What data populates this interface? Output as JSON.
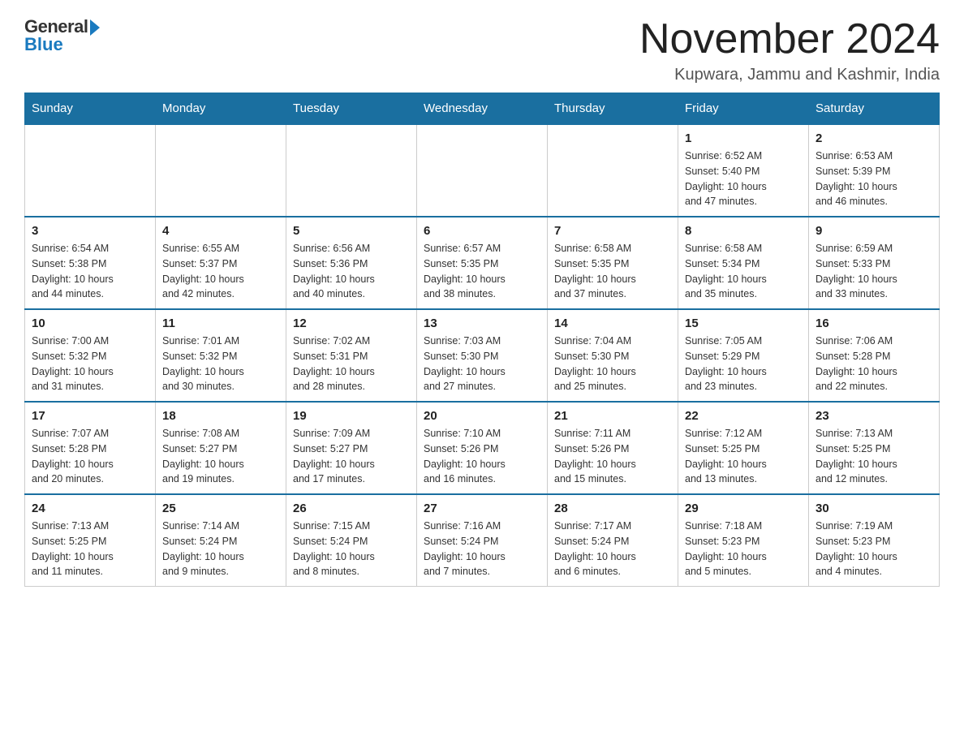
{
  "logo": {
    "general_text": "General",
    "blue_text": "Blue"
  },
  "header": {
    "month_year": "November 2024",
    "location": "Kupwara, Jammu and Kashmir, India"
  },
  "weekdays": [
    "Sunday",
    "Monday",
    "Tuesday",
    "Wednesday",
    "Thursday",
    "Friday",
    "Saturday"
  ],
  "weeks": [
    {
      "days": [
        {
          "number": "",
          "empty": true
        },
        {
          "number": "",
          "empty": true
        },
        {
          "number": "",
          "empty": true
        },
        {
          "number": "",
          "empty": true
        },
        {
          "number": "",
          "empty": true
        },
        {
          "number": "1",
          "sunrise": "6:52 AM",
          "sunset": "5:40 PM",
          "daylight": "10 hours and 47 minutes."
        },
        {
          "number": "2",
          "sunrise": "6:53 AM",
          "sunset": "5:39 PM",
          "daylight": "10 hours and 46 minutes."
        }
      ]
    },
    {
      "days": [
        {
          "number": "3",
          "sunrise": "6:54 AM",
          "sunset": "5:38 PM",
          "daylight": "10 hours and 44 minutes."
        },
        {
          "number": "4",
          "sunrise": "6:55 AM",
          "sunset": "5:37 PM",
          "daylight": "10 hours and 42 minutes."
        },
        {
          "number": "5",
          "sunrise": "6:56 AM",
          "sunset": "5:36 PM",
          "daylight": "10 hours and 40 minutes."
        },
        {
          "number": "6",
          "sunrise": "6:57 AM",
          "sunset": "5:35 PM",
          "daylight": "10 hours and 38 minutes."
        },
        {
          "number": "7",
          "sunrise": "6:58 AM",
          "sunset": "5:35 PM",
          "daylight": "10 hours and 37 minutes."
        },
        {
          "number": "8",
          "sunrise": "6:58 AM",
          "sunset": "5:34 PM",
          "daylight": "10 hours and 35 minutes."
        },
        {
          "number": "9",
          "sunrise": "6:59 AM",
          "sunset": "5:33 PM",
          "daylight": "10 hours and 33 minutes."
        }
      ]
    },
    {
      "days": [
        {
          "number": "10",
          "sunrise": "7:00 AM",
          "sunset": "5:32 PM",
          "daylight": "10 hours and 31 minutes."
        },
        {
          "number": "11",
          "sunrise": "7:01 AM",
          "sunset": "5:32 PM",
          "daylight": "10 hours and 30 minutes."
        },
        {
          "number": "12",
          "sunrise": "7:02 AM",
          "sunset": "5:31 PM",
          "daylight": "10 hours and 28 minutes."
        },
        {
          "number": "13",
          "sunrise": "7:03 AM",
          "sunset": "5:30 PM",
          "daylight": "10 hours and 27 minutes."
        },
        {
          "number": "14",
          "sunrise": "7:04 AM",
          "sunset": "5:30 PM",
          "daylight": "10 hours and 25 minutes."
        },
        {
          "number": "15",
          "sunrise": "7:05 AM",
          "sunset": "5:29 PM",
          "daylight": "10 hours and 23 minutes."
        },
        {
          "number": "16",
          "sunrise": "7:06 AM",
          "sunset": "5:28 PM",
          "daylight": "10 hours and 22 minutes."
        }
      ]
    },
    {
      "days": [
        {
          "number": "17",
          "sunrise": "7:07 AM",
          "sunset": "5:28 PM",
          "daylight": "10 hours and 20 minutes."
        },
        {
          "number": "18",
          "sunrise": "7:08 AM",
          "sunset": "5:27 PM",
          "daylight": "10 hours and 19 minutes."
        },
        {
          "number": "19",
          "sunrise": "7:09 AM",
          "sunset": "5:27 PM",
          "daylight": "10 hours and 17 minutes."
        },
        {
          "number": "20",
          "sunrise": "7:10 AM",
          "sunset": "5:26 PM",
          "daylight": "10 hours and 16 minutes."
        },
        {
          "number": "21",
          "sunrise": "7:11 AM",
          "sunset": "5:26 PM",
          "daylight": "10 hours and 15 minutes."
        },
        {
          "number": "22",
          "sunrise": "7:12 AM",
          "sunset": "5:25 PM",
          "daylight": "10 hours and 13 minutes."
        },
        {
          "number": "23",
          "sunrise": "7:13 AM",
          "sunset": "5:25 PM",
          "daylight": "10 hours and 12 minutes."
        }
      ]
    },
    {
      "days": [
        {
          "number": "24",
          "sunrise": "7:13 AM",
          "sunset": "5:25 PM",
          "daylight": "10 hours and 11 minutes."
        },
        {
          "number": "25",
          "sunrise": "7:14 AM",
          "sunset": "5:24 PM",
          "daylight": "10 hours and 9 minutes."
        },
        {
          "number": "26",
          "sunrise": "7:15 AM",
          "sunset": "5:24 PM",
          "daylight": "10 hours and 8 minutes."
        },
        {
          "number": "27",
          "sunrise": "7:16 AM",
          "sunset": "5:24 PM",
          "daylight": "10 hours and 7 minutes."
        },
        {
          "number": "28",
          "sunrise": "7:17 AM",
          "sunset": "5:24 PM",
          "daylight": "10 hours and 6 minutes."
        },
        {
          "number": "29",
          "sunrise": "7:18 AM",
          "sunset": "5:23 PM",
          "daylight": "10 hours and 5 minutes."
        },
        {
          "number": "30",
          "sunrise": "7:19 AM",
          "sunset": "5:23 PM",
          "daylight": "10 hours and 4 minutes."
        }
      ]
    }
  ]
}
